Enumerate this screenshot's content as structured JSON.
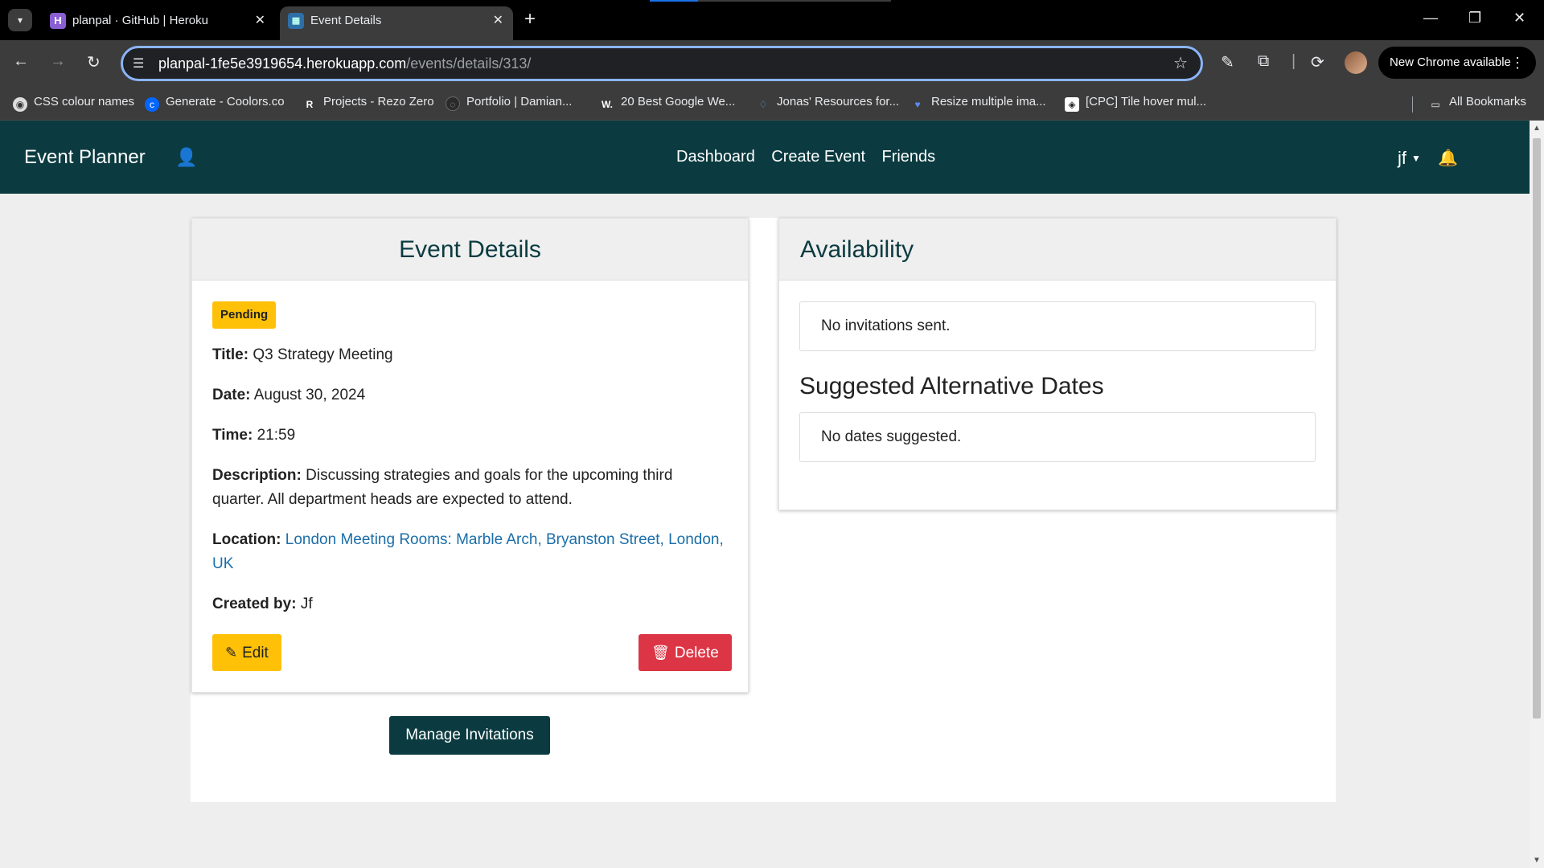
{
  "browser": {
    "tabs": [
      {
        "title": "planpal · GitHub | Heroku",
        "favicon": "H"
      },
      {
        "title": "Event Details",
        "favicon": "▦"
      }
    ],
    "url_host": "planpal-1fe5e3919654.herokuapp.com",
    "url_path": "/events/details/313/",
    "update_label": "New Chrome available",
    "bookmarks": [
      "CSS colour names",
      "Generate - Coolors.co",
      "Projects - Rezo Zero",
      "Portfolio | Damian...",
      "20 Best Google We...",
      "Jonas' Resources for...",
      "Resize multiple ima...",
      "[CPC] Tile hover mul...",
      "All Bookmarks"
    ]
  },
  "navbar": {
    "brand": "Event Planner",
    "links": [
      "Dashboard",
      "Create Event",
      "Friends"
    ],
    "user": "jf"
  },
  "event": {
    "header": "Event Details",
    "status": "Pending",
    "title_label": "Title:",
    "title": "Q3 Strategy Meeting",
    "date_label": "Date:",
    "date": "August 30, 2024",
    "time_label": "Time:",
    "time": "21:59",
    "description_label": "Description:",
    "description": "Discussing strategies and goals for the upcoming third quarter. All department heads are expected to attend.",
    "location_label": "Location:",
    "location": "London Meeting Rooms: Marble Arch, Bryanston Street, London, UK",
    "created_by_label": "Created by:",
    "created_by": "Jf",
    "edit_label": "Edit",
    "delete_label": "Delete"
  },
  "availability": {
    "header": "Availability",
    "invitations_text": "No invitations sent.",
    "suggested_heading": "Suggested Alternative Dates",
    "suggested_text": "No dates suggested."
  },
  "manage_invitations_label": "Manage Invitations",
  "colors": {
    "navbar": "#0b3b40",
    "badge": "#ffc107",
    "delete": "#dc3545",
    "link": "#1b6ea8"
  }
}
